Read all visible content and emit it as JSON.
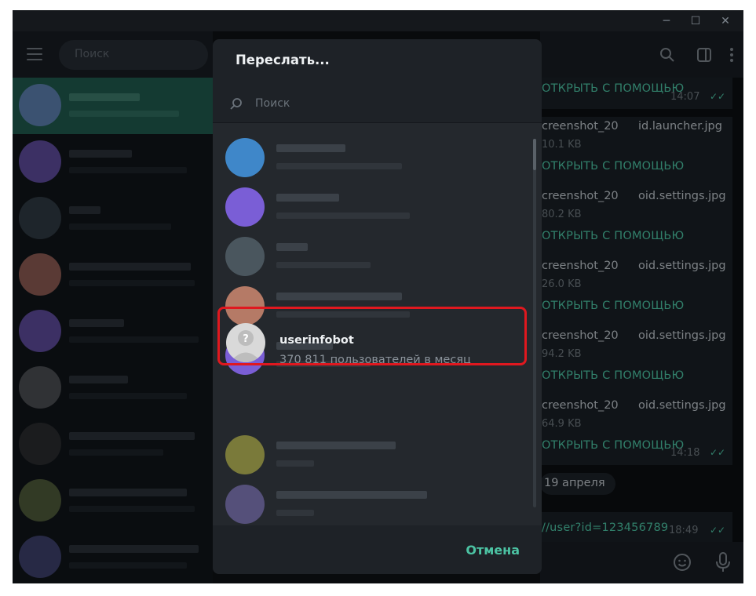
{
  "titlebar": {
    "minimize": "─",
    "maximize": "☐",
    "close": "✕"
  },
  "sidebar": {
    "search_placeholder": "Поиск"
  },
  "chat": {
    "open_with": "ОТКРЫТЬ С ПОМОЩЬЮ",
    "files": [
      {
        "name_start": "creenshot_20",
        "name_end": "id.launcher.jpg",
        "size": "10.1 KB"
      },
      {
        "name_start": "creenshot_20",
        "name_end": "oid.settings.jpg",
        "size": "80.2 KB"
      },
      {
        "name_start": "creenshot_20",
        "name_end": "oid.settings.jpg",
        "size": "26.0 KB"
      },
      {
        "name_start": "creenshot_20",
        "name_end": "oid.settings.jpg",
        "size": "94.2 KB"
      },
      {
        "name_start": "creenshot_20",
        "name_end": "oid.settings.jpg",
        "size": "64.9 KB"
      }
    ],
    "time_top": "14:07",
    "time_bottom": "14:18",
    "date_pill": "19 апреля",
    "link_text": "//user?id=123456789",
    "link_time": "18:49",
    "ticks": "✓✓"
  },
  "modal": {
    "title": "Переслать...",
    "search_placeholder": "Поиск",
    "selected": {
      "name": "userinfobot",
      "subtitle": "370 811 пользователей в месяц"
    },
    "cancel_label": "Отмена"
  },
  "colors": {
    "accent": "#4cc3a3",
    "highlight": "#e0181f",
    "background": "#0e1115"
  }
}
